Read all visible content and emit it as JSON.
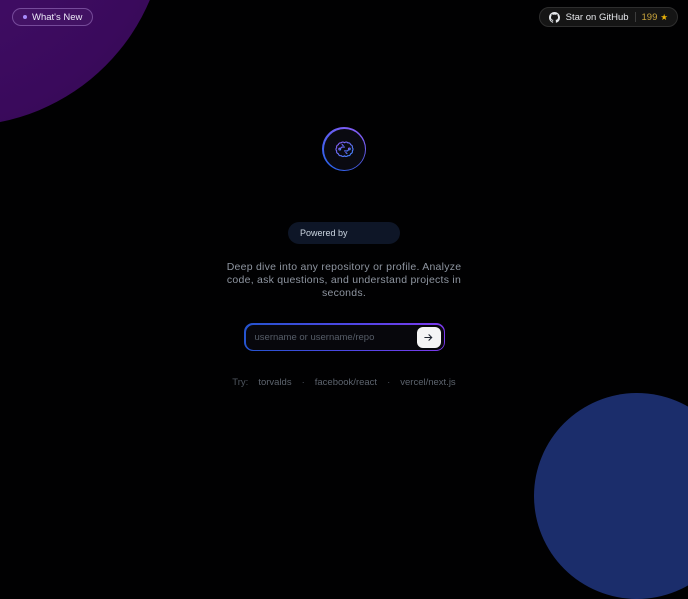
{
  "header": {
    "whats_new": {
      "label": "What's New"
    },
    "github": {
      "label": "Star on GitHub",
      "count": "199",
      "star_glyph": "★"
    }
  },
  "hero": {
    "powered_by_label": "Powered by",
    "headline_lines": {
      "0": "Deep dive into any repository or profile. Analyze",
      "1": "code, ask questions, and understand projects in",
      "2": "seconds."
    },
    "search": {
      "placeholder": "username or username/repo",
      "value": ""
    },
    "try": {
      "label": "Try:",
      "separator": "·",
      "examples": {
        "0": "torvalds",
        "1": "facebook/react",
        "2": "vercel/next.js"
      }
    }
  },
  "icons": {
    "github": "github-octocat-icon",
    "star": "star-icon",
    "arrow": "arrow-right-icon",
    "logo": "brain-circuit-icon",
    "dot": "new-indicator-dot"
  },
  "colors": {
    "background": "#010102",
    "decor_purple": "#3a0a5c",
    "decor_blue": "#1b2d6b",
    "accent_purple": "#8b5cf6",
    "accent_blue": "#2563eb",
    "star_gold": "#eab308",
    "headline_text": "#8e95a0"
  }
}
